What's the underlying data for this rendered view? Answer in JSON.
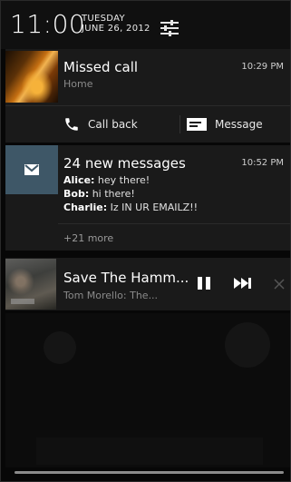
{
  "status": {
    "clock": "11:00",
    "day": "TUESDAY",
    "date": "JUNE 26, 2012"
  },
  "notifications": {
    "missed_call": {
      "title": "Missed call",
      "subtitle": "Home",
      "time": "10:29 PM",
      "actions": {
        "call_back": "Call back",
        "message": "Message"
      }
    },
    "gmail": {
      "title": "24 new messages",
      "time": "10:52 PM",
      "messages": [
        {
          "sender": "Alice:",
          "text": " hey there!"
        },
        {
          "sender": "Bob:",
          "text": " hi there!"
        },
        {
          "sender": "Charlie:",
          "text": " Iz IN UR EMAILZ!!"
        }
      ],
      "more": "+21 more"
    },
    "music": {
      "song": "Save The Hamm...",
      "artist": "Tom Morello: The..."
    }
  },
  "icons": {
    "settings": "settings-sliders-icon",
    "phone": "phone-icon",
    "message": "message-icon",
    "mail": "mail-icon",
    "pause": "pause-icon",
    "next": "next-track-icon",
    "close": "close-icon"
  },
  "colors": {
    "gmail_tile": "#3e5767",
    "card_bg": "#1a1a1a"
  }
}
